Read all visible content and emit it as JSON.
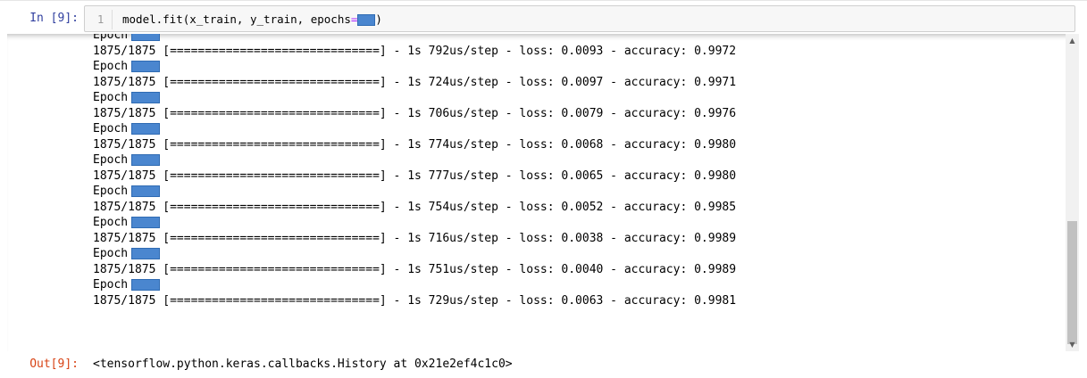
{
  "input_cell": {
    "prompt": "In [9]:",
    "line_number": "1",
    "code_before": "model.fit(x_train, y_train, epochs",
    "code_op": "=",
    "code_after": ")"
  },
  "output": {
    "lines": [
      {
        "kind": "epoch",
        "text": "Epoch"
      },
      {
        "kind": "step",
        "text": "1875/1875 [==============================] - 1s 792us/step - loss: 0.0093 - accuracy: 0.9972"
      },
      {
        "kind": "epoch",
        "text": "Epoch"
      },
      {
        "kind": "step",
        "text": "1875/1875 [==============================] - 1s 724us/step - loss: 0.0097 - accuracy: 0.9971"
      },
      {
        "kind": "epoch",
        "text": "Epoch"
      },
      {
        "kind": "step",
        "text": "1875/1875 [==============================] - 1s 706us/step - loss: 0.0079 - accuracy: 0.9976"
      },
      {
        "kind": "epoch",
        "text": "Epoch"
      },
      {
        "kind": "step",
        "text": "1875/1875 [==============================] - 1s 774us/step - loss: 0.0068 - accuracy: 0.9980"
      },
      {
        "kind": "epoch",
        "text": "Epoch"
      },
      {
        "kind": "step",
        "text": "1875/1875 [==============================] - 1s 777us/step - loss: 0.0065 - accuracy: 0.9980"
      },
      {
        "kind": "epoch",
        "text": "Epoch"
      },
      {
        "kind": "step",
        "text": "1875/1875 [==============================] - 1s 754us/step - loss: 0.0052 - accuracy: 0.9985"
      },
      {
        "kind": "epoch",
        "text": "Epoch"
      },
      {
        "kind": "step",
        "text": "1875/1875 [==============================] - 1s 716us/step - loss: 0.0038 - accuracy: 0.9989"
      },
      {
        "kind": "epoch",
        "text": "Epoch"
      },
      {
        "kind": "step",
        "text": "1875/1875 [==============================] - 1s 751us/step - loss: 0.0040 - accuracy: 0.9989"
      },
      {
        "kind": "epoch",
        "text": "Epoch"
      },
      {
        "kind": "step",
        "text": "1875/1875 [==============================] - 1s 729us/step - loss: 0.0063 - accuracy: 0.9981"
      }
    ]
  },
  "output_cell": {
    "prompt": "Out[9]:",
    "result": "<tensorflow.python.keras.callbacks.History at 0x21e2ef4c1c0>"
  },
  "icons": {
    "scroll_up": "triangle-up-icon",
    "scroll_down": "triangle-down-icon"
  },
  "colors": {
    "in_prompt": "#303f9f",
    "out_prompt": "#d84315",
    "redaction": "#4a86cf",
    "operator": "#aa22ff"
  }
}
